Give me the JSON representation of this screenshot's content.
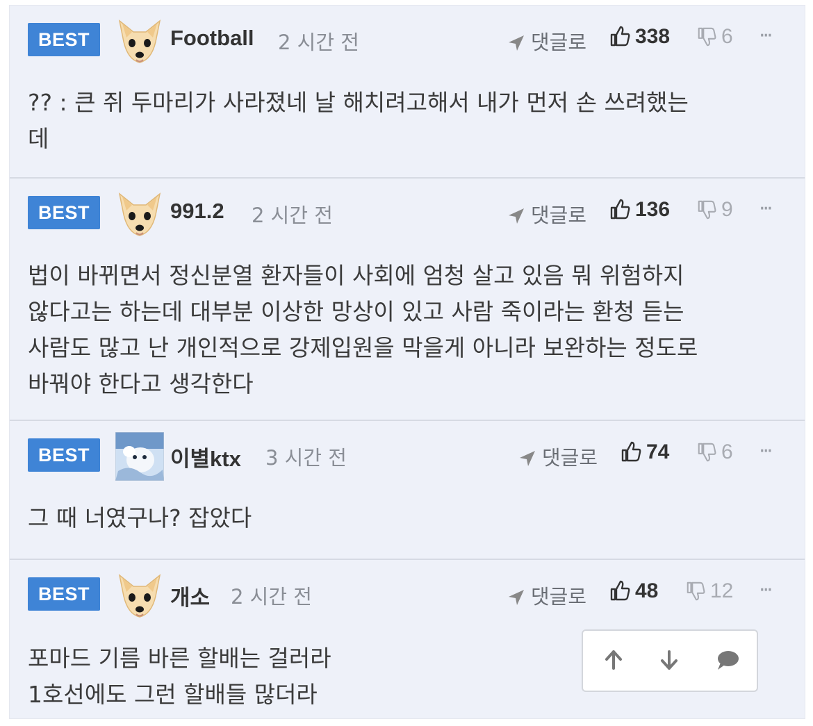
{
  "comments": [
    {
      "badge": "BEST",
      "nickname": "Football",
      "time": "2 시간 전",
      "reply_label": "댓글로",
      "upvotes": "338",
      "downvotes": "6",
      "text": "?? : 큰 쥐 두마리가 사라졌네 날 해치려고해서 내가 먼저 손 쓰려했는\n데",
      "avatar": "dog-face-avatar"
    },
    {
      "badge": "BEST",
      "nickname": "991.2",
      "time": "2 시간 전",
      "reply_label": "댓글로",
      "upvotes": "136",
      "downvotes": "9",
      "text": "법이 바뀌면서 정신분열 환자들이 사회에 엄청 살고 있음 뭐 위험하지\n않다고는 하는데 대부분 이상한 망상이 있고 사람 죽이라는 환청 듣는\n사람도 많고 난 개인적으로 강제입원을 막을게 아니라 보완하는 정도로\n바꿔야 한다고 생각한다",
      "avatar": "dog-face-avatar"
    },
    {
      "badge": "BEST",
      "nickname": "이별ktx",
      "time": "3 시간 전",
      "reply_label": "댓글로",
      "upvotes": "74",
      "downvotes": "6",
      "text": "그 때 너였구나? 잡았다",
      "avatar": "photo-avatar"
    },
    {
      "badge": "BEST",
      "nickname": "개소",
      "time": "2 시간 전",
      "reply_label": "댓글로",
      "upvotes": "48",
      "downvotes": "12",
      "text": "포마드 기름 바른 할배는 걸러라\n1호선에도 그런 할배들 많더라",
      "avatar": "dog-face-avatar"
    }
  ],
  "more_label": "···",
  "floating_actions": [
    "arrow-up-icon",
    "arrow-down-icon",
    "comment-bubble-icon"
  ],
  "colors": {
    "badge": "#3f84d6",
    "background": "#eef1f9",
    "divider": "#d6dae3"
  }
}
